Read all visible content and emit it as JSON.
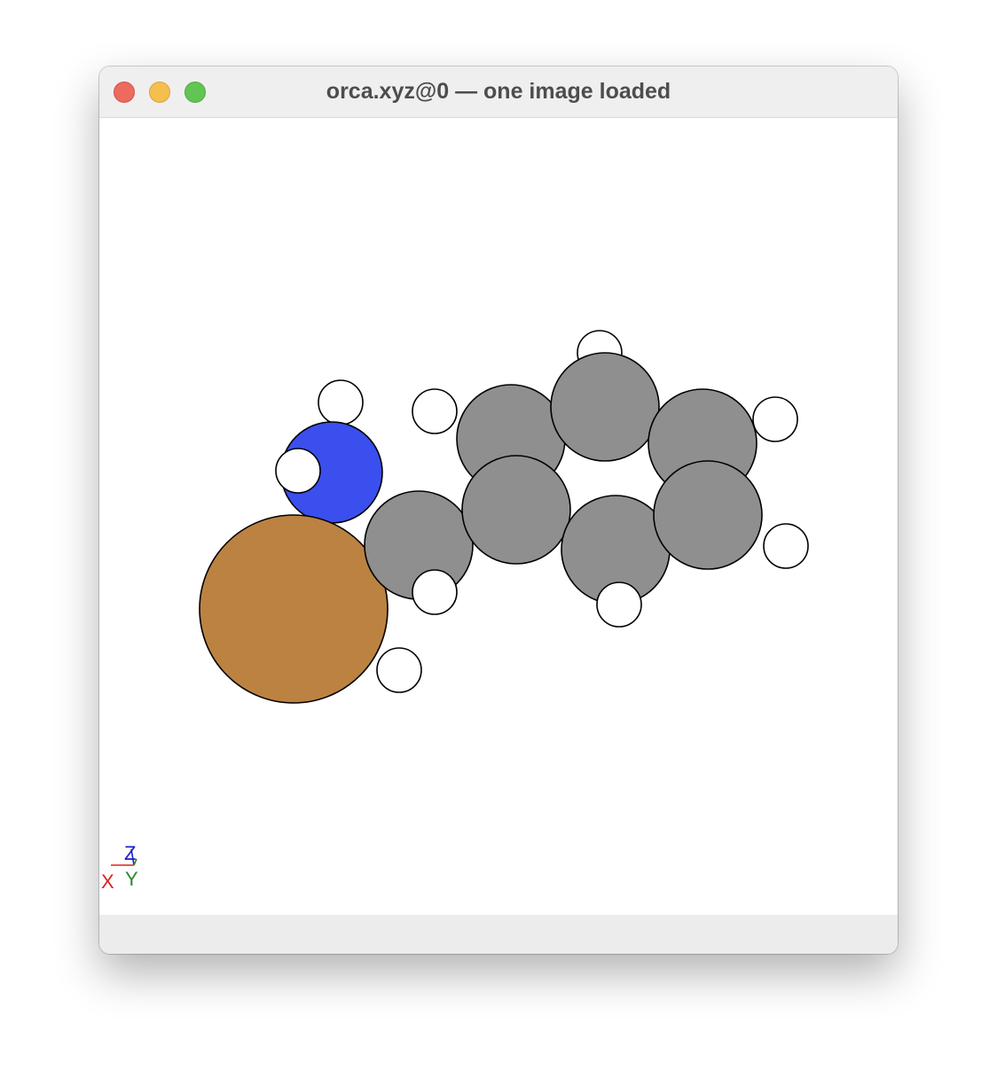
{
  "window": {
    "title": "orca.xyz@0 — one image loaded",
    "traffic_lights": [
      "close",
      "minimize",
      "zoom"
    ]
  },
  "viewer": {
    "background": "#ffffff",
    "element_colors": {
      "Cu": "#bc8241",
      "N": "#3a4fee",
      "C": "#8f8f8f",
      "H": "#ffffff"
    },
    "atoms": [
      {
        "element": "H",
        "name": "hydrogen-atom-top-benzene"
      },
      {
        "element": "H",
        "name": "hydrogen-atom-nitrogen-top"
      },
      {
        "element": "H",
        "name": "hydrogen-atom-upper-left"
      },
      {
        "element": "H",
        "name": "hydrogen-atom-right-upper"
      },
      {
        "element": "C",
        "name": "carbon-atom-ring-upper-left"
      },
      {
        "element": "C",
        "name": "carbon-atom-ring-top"
      },
      {
        "element": "C",
        "name": "carbon-atom-ring-upper-right"
      },
      {
        "element": "N",
        "name": "nitrogen-atom"
      },
      {
        "element": "H",
        "name": "hydrogen-atom-nitrogen-left"
      },
      {
        "element": "Cu",
        "name": "copper-atom"
      },
      {
        "element": "H",
        "name": "hydrogen-atom-lower-copper"
      },
      {
        "element": "C",
        "name": "carbon-atom-methylene"
      },
      {
        "element": "C",
        "name": "carbon-atom-ring-center-left"
      },
      {
        "element": "C",
        "name": "carbon-atom-ring-bottom"
      },
      {
        "element": "C",
        "name": "carbon-atom-ring-lower-right"
      },
      {
        "element": "H",
        "name": "hydrogen-atom-methylene"
      },
      {
        "element": "H",
        "name": "hydrogen-atom-ring-bottom"
      },
      {
        "element": "H",
        "name": "hydrogen-atom-right-lower"
      }
    ],
    "axes": {
      "x": {
        "label": "X",
        "color": "#dd2222"
      },
      "y": {
        "label": "Y",
        "color": "#2a8a2a"
      },
      "z": {
        "label": "Z",
        "color": "#1c1ccf"
      }
    }
  }
}
